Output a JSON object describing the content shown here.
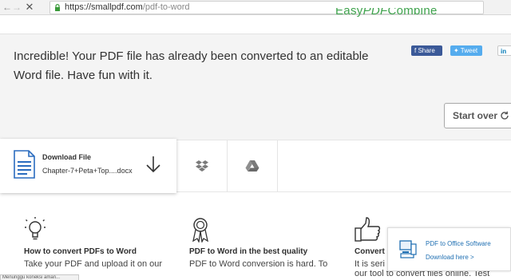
{
  "browser": {
    "url_host": "https://smallpdf.com",
    "url_path": "/pdf-to-word"
  },
  "ad_top": {
    "logo_text_1": "Easy",
    "logo_text_2": "PDF",
    "logo_text_3": "Combine"
  },
  "result": {
    "message": "Incredible! Your PDF file has already been converted to an editable Word file. Have fun with it.",
    "share_facebook": "f Share",
    "share_twitter": "Tweet",
    "share_linkedin": "in",
    "start_over_label": "Start over"
  },
  "download": {
    "title": "Download File",
    "filename": "Chapter-7+Peta+Top....docx"
  },
  "features": [
    {
      "title": "How to convert PDFs to Word",
      "text": "Take your PDF and upload it on our"
    },
    {
      "title": "PDF to Word in the best quality",
      "text": "PDF to Word conversion is hard. To"
    },
    {
      "title": "Convert",
      "text": "It is seri",
      "text2": "our tool to convert files online. Test"
    }
  ],
  "popup_ad": {
    "title": "PDF to Office Software",
    "link": "Download here >"
  },
  "status_bar": {
    "text": "Menunggu koneksi aman..."
  },
  "colors": {
    "facebook": "#3b5998",
    "twitter": "#55acee",
    "file_icon": "#2a6cbf",
    "ad_green": "#3fa34d",
    "link_blue": "#1f6fb2"
  }
}
